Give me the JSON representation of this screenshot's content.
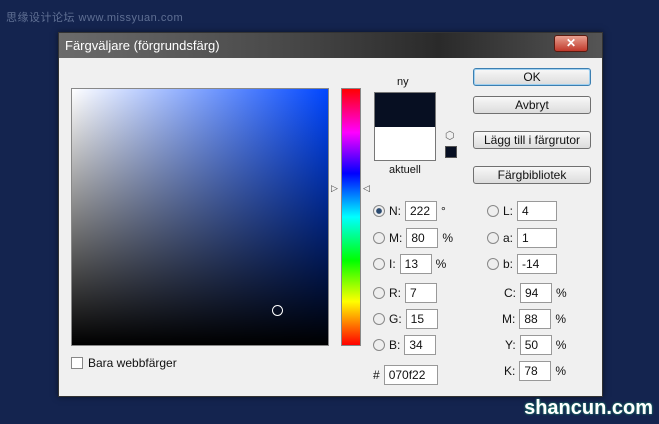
{
  "watermark": "思缘设计论坛 www.missyuan.com",
  "logo": "shancun.com",
  "dialog": {
    "title": "Färgväljare (förgrundsfärg)",
    "close": "✕"
  },
  "swatch": {
    "new_label": "ny",
    "current_label": "aktuell",
    "new_color": "#070f22",
    "current_color": "#ffffff"
  },
  "buttons": {
    "ok": "OK",
    "cancel": "Avbryt",
    "add": "Lägg till i färgrutor",
    "library": "Färgbibliotek"
  },
  "web_only": "Bara webbfärger",
  "hsb": [
    {
      "label": "N:",
      "value": "222",
      "unit": "°"
    },
    {
      "label": "M:",
      "value": "80",
      "unit": "%"
    },
    {
      "label": "I:",
      "value": "13",
      "unit": "%"
    }
  ],
  "rgb": [
    {
      "label": "R:",
      "value": "7"
    },
    {
      "label": "G:",
      "value": "15"
    },
    {
      "label": "B:",
      "value": "34"
    }
  ],
  "lab": [
    {
      "label": "L:",
      "value": "4"
    },
    {
      "label": "a:",
      "value": "1"
    },
    {
      "label": "b:",
      "value": "-14"
    }
  ],
  "cmyk": [
    {
      "label": "C:",
      "value": "94",
      "unit": "%"
    },
    {
      "label": "M:",
      "value": "88",
      "unit": "%"
    },
    {
      "label": "Y:",
      "value": "50",
      "unit": "%"
    },
    {
      "label": "K:",
      "value": "78",
      "unit": "%"
    }
  ],
  "hex": {
    "label": "#",
    "value": "070f22"
  }
}
